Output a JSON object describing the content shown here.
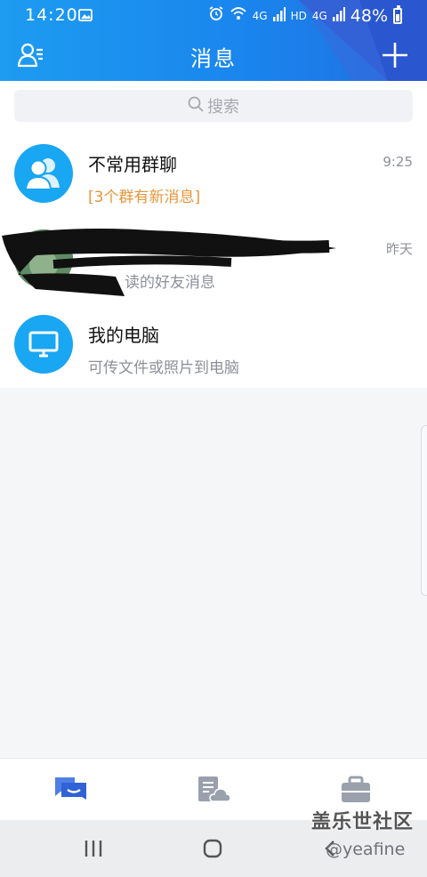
{
  "status_bar": {
    "time": "14:20",
    "network_label": "4G",
    "hd_label": "HD",
    "network_label_2": "4G",
    "battery": "48%",
    "icons": [
      "gallery-icon",
      "alarm-icon",
      "wifi-icon",
      "signal-icon",
      "signal-icon",
      "battery-icon"
    ]
  },
  "header": {
    "title": "消息",
    "left_icon": "contacts-icon",
    "right_icon": "plus-icon"
  },
  "search": {
    "placeholder": "搜索",
    "icon": "search-icon"
  },
  "conversations": [
    {
      "name": "不常用群聊",
      "subtitle": "[3个群有新消息]",
      "time": "9:25",
      "avatar_icon": "group-chat-icon",
      "avatar_color": "#19a6f2",
      "subtitle_color": "#e8963a"
    },
    {
      "name": "",
      "subtitle": "读的好友消息",
      "time": "昨天",
      "avatar_icon": "friend-avatar-image",
      "redacted": true
    },
    {
      "name": "我的电脑",
      "subtitle": "可传文件或照片到电脑",
      "time": "",
      "avatar_icon": "computer-icon",
      "avatar_color": "#19a6f2"
    }
  ],
  "tab_bar": {
    "tabs": [
      {
        "name": "messages",
        "icon": "messages-tab-icon",
        "active": true,
        "color": "#2f63d6"
      },
      {
        "name": "feeds",
        "icon": "cloud-doc-tab-icon",
        "active": false,
        "color": "#9aa1ad"
      },
      {
        "name": "workbench",
        "icon": "briefcase-tab-icon",
        "active": false,
        "color": "#9aa1ad"
      }
    ]
  },
  "nav_bar": {
    "watermark_title": "盖乐世社区",
    "watermark_handle": "@yeafine"
  },
  "colors": {
    "brand_blue": "#1a86ee",
    "accent_orange": "#e8963a",
    "background": "#f5f6f8"
  }
}
